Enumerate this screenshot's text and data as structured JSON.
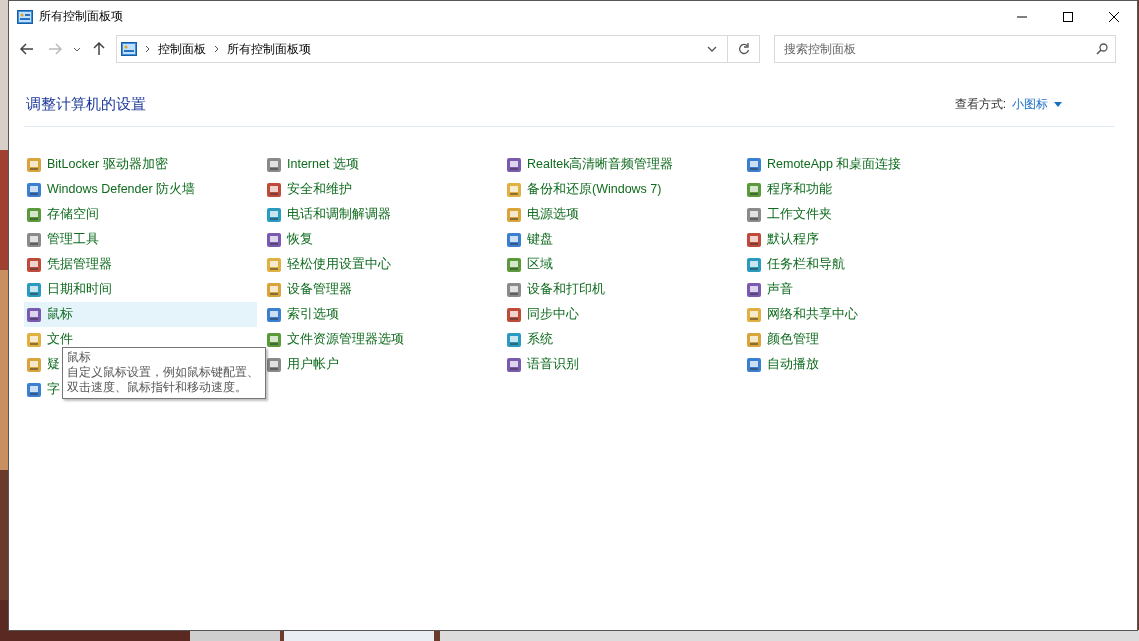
{
  "window": {
    "title": "所有控制面板项"
  },
  "address_bar": {
    "path": [
      "控制面板",
      "所有控制面板项"
    ]
  },
  "search": {
    "placeholder": "搜索控制面板"
  },
  "heading": "调整计算机的设置",
  "view_by": {
    "label": "查看方式:",
    "value": "小图标"
  },
  "columns": [
    [
      {
        "label": "BitLocker 驱动器加密",
        "hovered": false
      },
      {
        "label": "Windows Defender 防火墙",
        "hovered": false
      },
      {
        "label": "存储空间",
        "hovered": false
      },
      {
        "label": "管理工具",
        "hovered": false
      },
      {
        "label": "凭据管理器",
        "hovered": false
      },
      {
        "label": "日期和时间",
        "hovered": false
      },
      {
        "label": "鼠标",
        "hovered": true
      },
      {
        "label": "文件",
        "hovered": false
      },
      {
        "label": "疑",
        "hovered": false
      },
      {
        "label": "字",
        "hovered": false
      }
    ],
    [
      {
        "label": "Internet 选项",
        "hovered": false
      },
      {
        "label": "安全和维护",
        "hovered": false
      },
      {
        "label": "电话和调制解调器",
        "hovered": false
      },
      {
        "label": "恢复",
        "hovered": false
      },
      {
        "label": "轻松使用设置中心",
        "hovered": false
      },
      {
        "label": "设备管理器",
        "hovered": false
      },
      {
        "label": "索引选项",
        "hovered": false
      },
      {
        "label": "文件资源管理器选项",
        "hovered": false
      },
      {
        "label": "用户帐户",
        "hovered": false
      }
    ],
    [
      {
        "label": "Realtek高清晰音频管理器",
        "hovered": false
      },
      {
        "label": "备份和还原(Windows 7)",
        "hovered": false
      },
      {
        "label": "电源选项",
        "hovered": false
      },
      {
        "label": "键盘",
        "hovered": false
      },
      {
        "label": "区域",
        "hovered": false
      },
      {
        "label": "设备和打印机",
        "hovered": false
      },
      {
        "label": "同步中心",
        "hovered": false
      },
      {
        "label": "系统",
        "hovered": false
      },
      {
        "label": "语音识别",
        "hovered": false
      }
    ],
    [
      {
        "label": "RemoteApp 和桌面连接",
        "hovered": false
      },
      {
        "label": "程序和功能",
        "hovered": false
      },
      {
        "label": "工作文件夹",
        "hovered": false
      },
      {
        "label": "默认程序",
        "hovered": false
      },
      {
        "label": "任务栏和导航",
        "hovered": false
      },
      {
        "label": "声音",
        "hovered": false
      },
      {
        "label": "网络和共享中心",
        "hovered": false
      },
      {
        "label": "颜色管理",
        "hovered": false
      },
      {
        "label": "自动播放",
        "hovered": false
      }
    ]
  ],
  "tooltip": {
    "title": "鼠标",
    "description": "自定义鼠标设置，例如鼠标键配置、双击速度、鼠标指针和移动速度。"
  }
}
